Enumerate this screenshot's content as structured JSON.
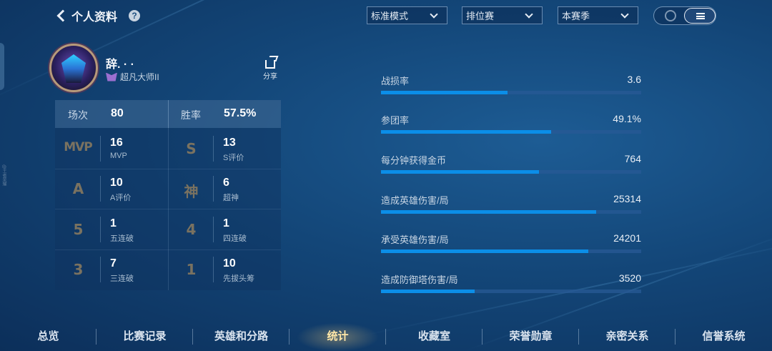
{
  "header": {
    "title": "个人资料",
    "help_icon": "?"
  },
  "filters": {
    "mode": "标准模式",
    "match_type": "排位赛",
    "season": "本赛季"
  },
  "side_text": "@王者荣耀",
  "profile": {
    "name": "辞.  ·  ·",
    "rank": "超凡大师II",
    "share_label": "分享"
  },
  "summary": {
    "games_label": "场次",
    "games": "80",
    "winrate_label": "胜率",
    "winrate": "57.5%"
  },
  "stat_cells": [
    {
      "badge": "MVP",
      "value": "16",
      "label": "MVP"
    },
    {
      "badge": "S",
      "value": "13",
      "label": "S评价"
    },
    {
      "badge": "A",
      "value": "10",
      "label": "A评价"
    },
    {
      "badge": "神",
      "value": "6",
      "label": "超神"
    },
    {
      "badge": "5",
      "value": "1",
      "label": "五连破"
    },
    {
      "badge": "4",
      "value": "1",
      "label": "四连破"
    },
    {
      "badge": "3",
      "value": "7",
      "label": "三连破"
    },
    {
      "badge": "1",
      "value": "10",
      "label": "先拔头筹"
    }
  ],
  "metrics": [
    {
      "label": "战损率",
      "value": "3.6",
      "fill": 0.487
    },
    {
      "label": "参团率",
      "value": "49.1%",
      "fill": 0.654
    },
    {
      "label": "每分钟获得金币",
      "value": "764",
      "fill": 0.607
    },
    {
      "label": "造成英雄伤害/局",
      "value": "25314",
      "fill": 0.827
    },
    {
      "label": "承受英雄伤害/局",
      "value": "24201",
      "fill": 0.796
    },
    {
      "label": "造成防御塔伤害/局",
      "value": "3520",
      "fill": 0.36
    }
  ],
  "nav": [
    "总览",
    "比赛记录",
    "英雄和分路",
    "统计",
    "收藏室",
    "荣誉勋章",
    "亲密关系",
    "信誉系统"
  ],
  "nav_active": "统计",
  "colors": {
    "bar_fill": "#0b8ee8",
    "badge_gold": "#7a7260",
    "active_tab": "#ffe7a8"
  }
}
